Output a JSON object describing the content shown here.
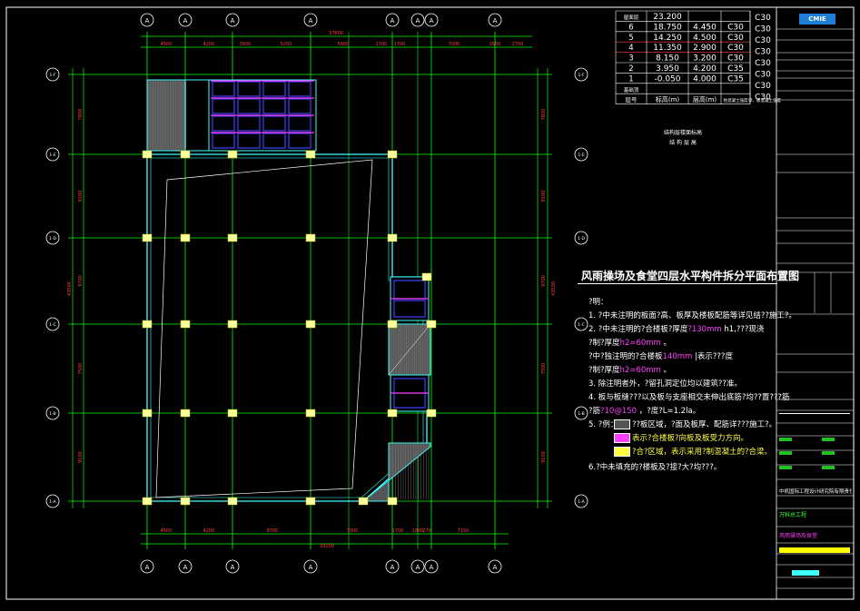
{
  "drawing": {
    "title": "风雨操场及食堂四层水平构件拆分平面布置图",
    "axis_label": "A"
  },
  "grid": {
    "left_labels": [
      "1-F",
      "1-E",
      "1-D",
      "1-C",
      "1-B",
      "1-A"
    ],
    "right_labels": [
      "1-F",
      "1-E",
      "1-D",
      "1-C",
      "1-B",
      "1-A"
    ],
    "top_dims": [
      "4500",
      "4200",
      "3900",
      "5200",
      "5900",
      "1700",
      "1700",
      "7000",
      "1500",
      "2700"
    ],
    "top_total": "37600",
    "bottom_dims": [
      "4500",
      "4200",
      "8700",
      "7000",
      "1700",
      "1800",
      "270",
      "7150"
    ],
    "bottom_total": "33100"
  },
  "level_table": {
    "rows": [
      {
        "no": "屋面层",
        "elev": "23.200",
        "height": "",
        "grade": ""
      },
      {
        "no": "6",
        "elev": "18.750",
        "height": "4.450",
        "grade": "C30"
      },
      {
        "no": "5",
        "elev": "14.250",
        "height": "4.500",
        "grade": "C30"
      },
      {
        "no": "4",
        "elev": "11.350",
        "height": "2.900",
        "grade": "C30"
      },
      {
        "no": "3",
        "elev": "8.150",
        "height": "3.200",
        "grade": "C30"
      },
      {
        "no": "2",
        "elev": "3.950",
        "height": "4.200",
        "grade": "C35"
      },
      {
        "no": "1",
        "elev": "-0.050",
        "height": "4.000",
        "grade": "C35"
      },
      {
        "no": "基础顶",
        "elev": "",
        "height": "",
        "grade": ""
      }
    ],
    "header": {
      "no": "层号",
      "elev": "标高(m)",
      "height": "层高(m)",
      "grade1": "柱混凝土强度",
      "grade2": "梁、板混凝土强度"
    },
    "right_grades": [
      "C30",
      "C30",
      "C30",
      "C30",
      "C30",
      "C30",
      "C30",
      "C30"
    ],
    "caption1": "结构层楼面标高",
    "caption2": "结 构 层 高"
  },
  "notes": {
    "heading": "?明：",
    "lines": [
      {
        "pre": "1. ?中未注明的板面?高、板厚及楼板配筋等详见结??施工?。",
        "hl": "",
        "post": ""
      },
      {
        "pre": "2. ?中未注明的?合楼板?厚度",
        "hl": "?130mm",
        "post": "   h1,???现浇"
      },
      {
        "pre": "   ?制?厚度",
        "hl": "h2=60mm",
        "post": "     。"
      },
      {
        "pre": "   ?中?独注明的?合楼板",
        "hl": "140mm",
        "post": "    |表示???度"
      },
      {
        "pre": "   ?制?厚度",
        "hl": "h2=60mm",
        "post": "     。"
      },
      {
        "pre": "3. 除注明者外，?留孔洞定位均以建筑??准。",
        "hl": "",
        "post": ""
      },
      {
        "pre": "4. 板与板缝???以及板与支座相交未伸出底筋?均??置???筋",
        "hl": "",
        "post": ""
      },
      {
        "pre": "   ?筋",
        "hl": "?10@150",
        "post": "   ，?度?L=1.2la。"
      },
      {
        "pre": "5. ?例：",
        "hl": "",
        "post": ""
      }
    ],
    "legend": [
      "??板区域，?面及板厚、配筋详???施工?。",
      "表示?合楼板?向板及板受力方向。",
      "?合?区域，表示采用?制混凝土的?合梁。"
    ],
    "last": "6.?中未填充的?楼板及?接?大?均???。"
  },
  "title_block": {
    "company": "中机国际工程设计研究院有限责任公司",
    "project": "万科总工程",
    "drawing_name": "风雨操场及食堂",
    "logo": "CMIE"
  },
  "colors": {
    "grid": "#00ff00",
    "wall": "#40ffff",
    "panel": "#4040ff",
    "beam": "#ff40ff",
    "column": "#ffffa0",
    "dim": "#ff4040",
    "text": "#ffffff"
  }
}
